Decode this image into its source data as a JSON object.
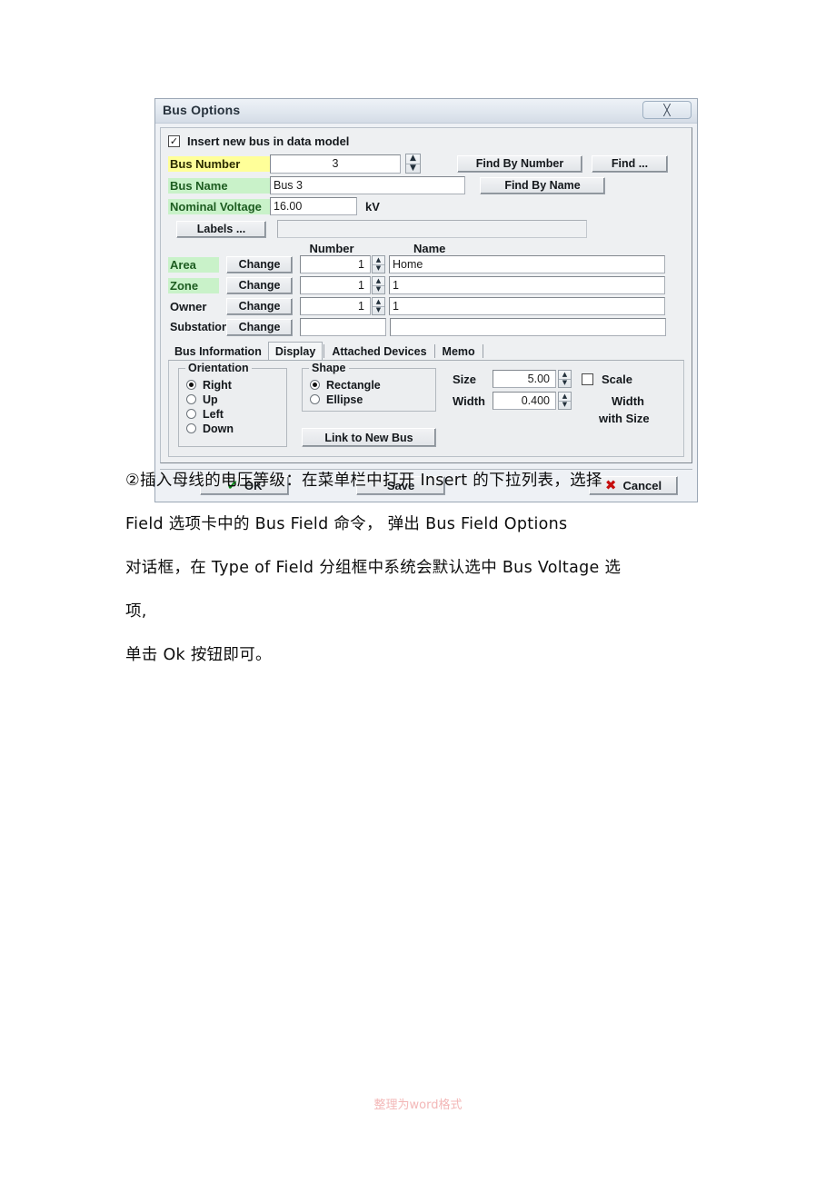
{
  "dialog": {
    "title": "Bus Options",
    "close_icon": "close-x",
    "insert_checkbox": {
      "label": "Insert new bus in data model",
      "checked": true
    },
    "fields": {
      "bus_number": {
        "label": "Bus Number",
        "value": "3",
        "highlight": "#ffff99"
      },
      "bus_name": {
        "label": "Bus Name",
        "value": "Bus 3",
        "highlight": "#c9f2c9"
      },
      "nominal_voltage": {
        "label": "Nominal Voltage",
        "value": "16.00",
        "unit": "kV",
        "highlight": "#c9f2c9"
      },
      "labels_button": "Labels ...",
      "labels_value": ""
    },
    "find_buttons": {
      "find_by_number": "Find By Number",
      "find": "Find ...",
      "find_by_name": "Find By Name"
    },
    "grid": {
      "headers": {
        "number": "Number",
        "name": "Name"
      },
      "rows": [
        {
          "label": "Area",
          "highlight": "#c9f2c9",
          "change": "Change",
          "number": "1",
          "name": "Home",
          "has_spinner": true
        },
        {
          "label": "Zone",
          "highlight": "#c9f2c9",
          "change": "Change",
          "number": "1",
          "name": "1",
          "has_spinner": true
        },
        {
          "label": "Owner",
          "highlight": "none",
          "change": "Change",
          "number": "1",
          "name": "1",
          "has_spinner": true
        },
        {
          "label": "Substation",
          "highlight": "none",
          "change": "Change",
          "number": "",
          "name": "",
          "has_spinner": false
        }
      ]
    },
    "tabs": [
      {
        "label": "Bus Information",
        "active": false
      },
      {
        "label": "Display",
        "active": true
      },
      {
        "label": "Attached Devices",
        "active": false
      },
      {
        "label": "Memo",
        "active": false
      }
    ],
    "display_tab": {
      "orientation": {
        "legend": "Orientation",
        "options": [
          {
            "label": "Right",
            "selected": true
          },
          {
            "label": "Up",
            "selected": false
          },
          {
            "label": "Left",
            "selected": false
          },
          {
            "label": "Down",
            "selected": false
          }
        ]
      },
      "shape": {
        "legend": "Shape",
        "options": [
          {
            "label": "Rectangle",
            "selected": true
          },
          {
            "label": "Ellipse",
            "selected": false
          }
        ]
      },
      "link_button": "Link to New Bus",
      "size": {
        "label": "Size",
        "value": "5.00"
      },
      "width": {
        "label": "Width",
        "value": "0.400"
      },
      "scale_checkbox": {
        "line1": "Scale",
        "line2": "Width",
        "line3": "with Size",
        "checked": false
      }
    },
    "buttons": {
      "ok": {
        "label": "OK",
        "icon": "check-icon",
        "color": "#0a8a16"
      },
      "save": {
        "label": "Save"
      },
      "cancel": {
        "label": "Cancel",
        "icon": "x-icon",
        "color": "#c60d0d"
      }
    }
  },
  "document": {
    "paragraphs": [
      "②插入母线的电压等级：在菜单栏中打开 Insert 的下拉列表，选择",
      "Field 选项卡中的 Bus Field 命令， 弹出 Bus Field Options",
      "对话框，在 Type of Field 分组框中系统会默认选中 Bus Voltage 选",
      "项,",
      "单击 Ok 按钮即可。"
    ],
    "footer": "整理为word格式"
  }
}
